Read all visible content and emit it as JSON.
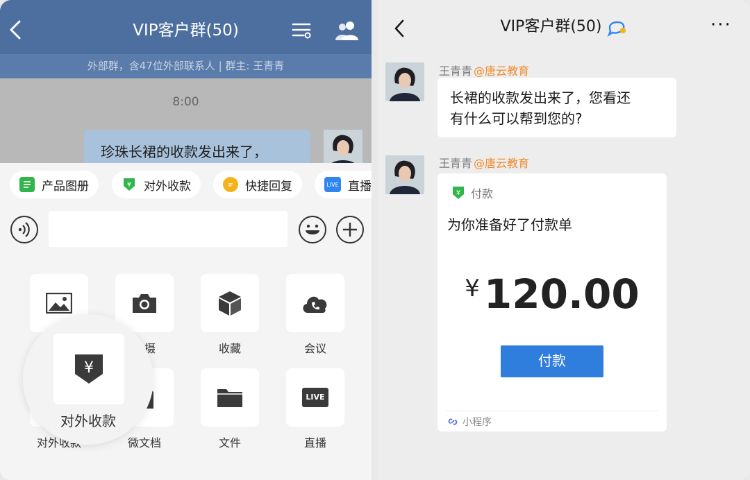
{
  "left": {
    "header": {
      "back_icon": "chevron-left-icon",
      "title": "VIP客户群(50)",
      "menu_icon": "list-settings-icon",
      "members_icon": "people-icon",
      "subtitle": "外部群，含47位外部联系人 | 群主: 王青青"
    },
    "chat": {
      "time": "8:00",
      "message": "珍珠长裙的收款发出来了，"
    },
    "quick_bar": [
      {
        "label": "产品图册",
        "icon": "catalog-icon",
        "color": "#2fb54a"
      },
      {
        "label": "对外收款",
        "icon": "shield-yuan-icon",
        "color": "#2fb54a"
      },
      {
        "label": "快捷回复",
        "icon": "chat-bubble-icon",
        "color": "#f5b31b"
      },
      {
        "label": "直播",
        "icon": "live-icon",
        "color": "#2f86f0"
      }
    ],
    "live_badge": "LIVE",
    "input": {
      "placeholder": ""
    },
    "tools": [
      {
        "label": "",
        "icon": "image-icon"
      },
      {
        "label": "拍摄",
        "icon": "camera-icon"
      },
      {
        "label": "收藏",
        "icon": "cube-icon"
      },
      {
        "label": "会议",
        "icon": "cloud-phone-icon"
      },
      {
        "label": "对外收款",
        "icon": "shield-yuan-icon"
      },
      {
        "label": "微文档",
        "icon": "document-icon"
      },
      {
        "label": "文件",
        "icon": "folder-icon"
      },
      {
        "label": "直播",
        "icon": "live-icon"
      }
    ],
    "zoom": {
      "label": "对外收款",
      "symbol": "¥"
    }
  },
  "right": {
    "header": {
      "title": "VIP客户群(50)",
      "more": "···"
    },
    "messages": [
      {
        "sender": "王青青",
        "org": "@唐云教育",
        "text_line1": "长裙的收款发出来了，您看还",
        "text_line2": "有什么可以帮到您的?"
      },
      {
        "sender": "王青青",
        "org": "@唐云教育"
      }
    ],
    "card": {
      "badge_symbol": "¥",
      "title": "付款",
      "description": "为你准备好了付款单",
      "currency": "¥",
      "amount": "120.00",
      "button": "付款",
      "footer": "小程序"
    }
  }
}
